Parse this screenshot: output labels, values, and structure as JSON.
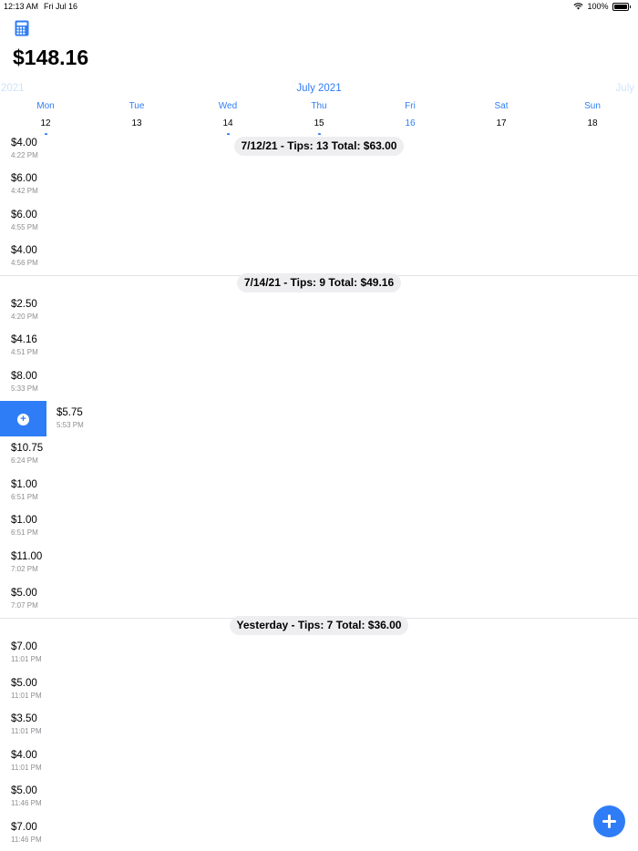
{
  "status_bar": {
    "time": "12:13 AM",
    "date": "Fri Jul 16",
    "battery": "100%"
  },
  "toolbar": {
    "calculator_icon": "calculator-icon"
  },
  "balance": "$148.16",
  "calendar": {
    "prev_label": "2021",
    "month_label": "July 2021",
    "next_label": "July",
    "days": [
      {
        "name": "Mon",
        "num": "12",
        "has_entries": true,
        "today": false
      },
      {
        "name": "Tue",
        "num": "13",
        "has_entries": false,
        "today": false
      },
      {
        "name": "Wed",
        "num": "14",
        "has_entries": true,
        "today": false
      },
      {
        "name": "Thu",
        "num": "15",
        "has_entries": true,
        "today": false
      },
      {
        "name": "Fri",
        "num": "16",
        "has_entries": false,
        "today": true
      },
      {
        "name": "Sat",
        "num": "17",
        "has_entries": false,
        "today": false
      },
      {
        "name": "Sun",
        "num": "18",
        "has_entries": false,
        "today": false
      }
    ]
  },
  "sections": [
    {
      "header": "7/12/21 - Tips: 13  Total: $63.00"
    },
    {
      "header": "7/14/21 - Tips: 9  Total: $49.16"
    },
    {
      "header": "Yesterday - Tips: 7  Total: $36.00"
    }
  ],
  "rows": [
    {
      "amount": "$4.00",
      "time": "4:22 PM"
    },
    {
      "amount": "$6.00",
      "time": "4:42 PM"
    },
    {
      "amount": "$6.00",
      "time": "4:55 PM"
    },
    {
      "amount": "$4.00",
      "time": "4:56 PM"
    },
    {
      "amount": "$2.50",
      "time": "4:20 PM"
    },
    {
      "amount": "$4.16",
      "time": "4:51 PM"
    },
    {
      "amount": "$8.00",
      "time": "5:33 PM"
    },
    {
      "amount": "$5.75",
      "time": "5:53 PM"
    },
    {
      "amount": "$10.75",
      "time": "6:24 PM"
    },
    {
      "amount": "$1.00",
      "time": "6:51 PM"
    },
    {
      "amount": "$1.00",
      "time": "6:51 PM"
    },
    {
      "amount": "$11.00",
      "time": "7:02 PM"
    },
    {
      "amount": "$5.00",
      "time": "7:07 PM"
    },
    {
      "amount": "$7.00",
      "time": "11:01 PM"
    },
    {
      "amount": "$5.00",
      "time": "11:01 PM"
    },
    {
      "amount": "$3.50",
      "time": "11:01 PM"
    },
    {
      "amount": "$4.00",
      "time": "11:01 PM"
    },
    {
      "amount": "$5.00",
      "time": "11:46 PM"
    },
    {
      "amount": "$7.00",
      "time": "11:46 PM"
    }
  ],
  "colors": {
    "accent": "#2f7df6",
    "pill": "#eeeef0",
    "separator": "#e3e3e6"
  }
}
